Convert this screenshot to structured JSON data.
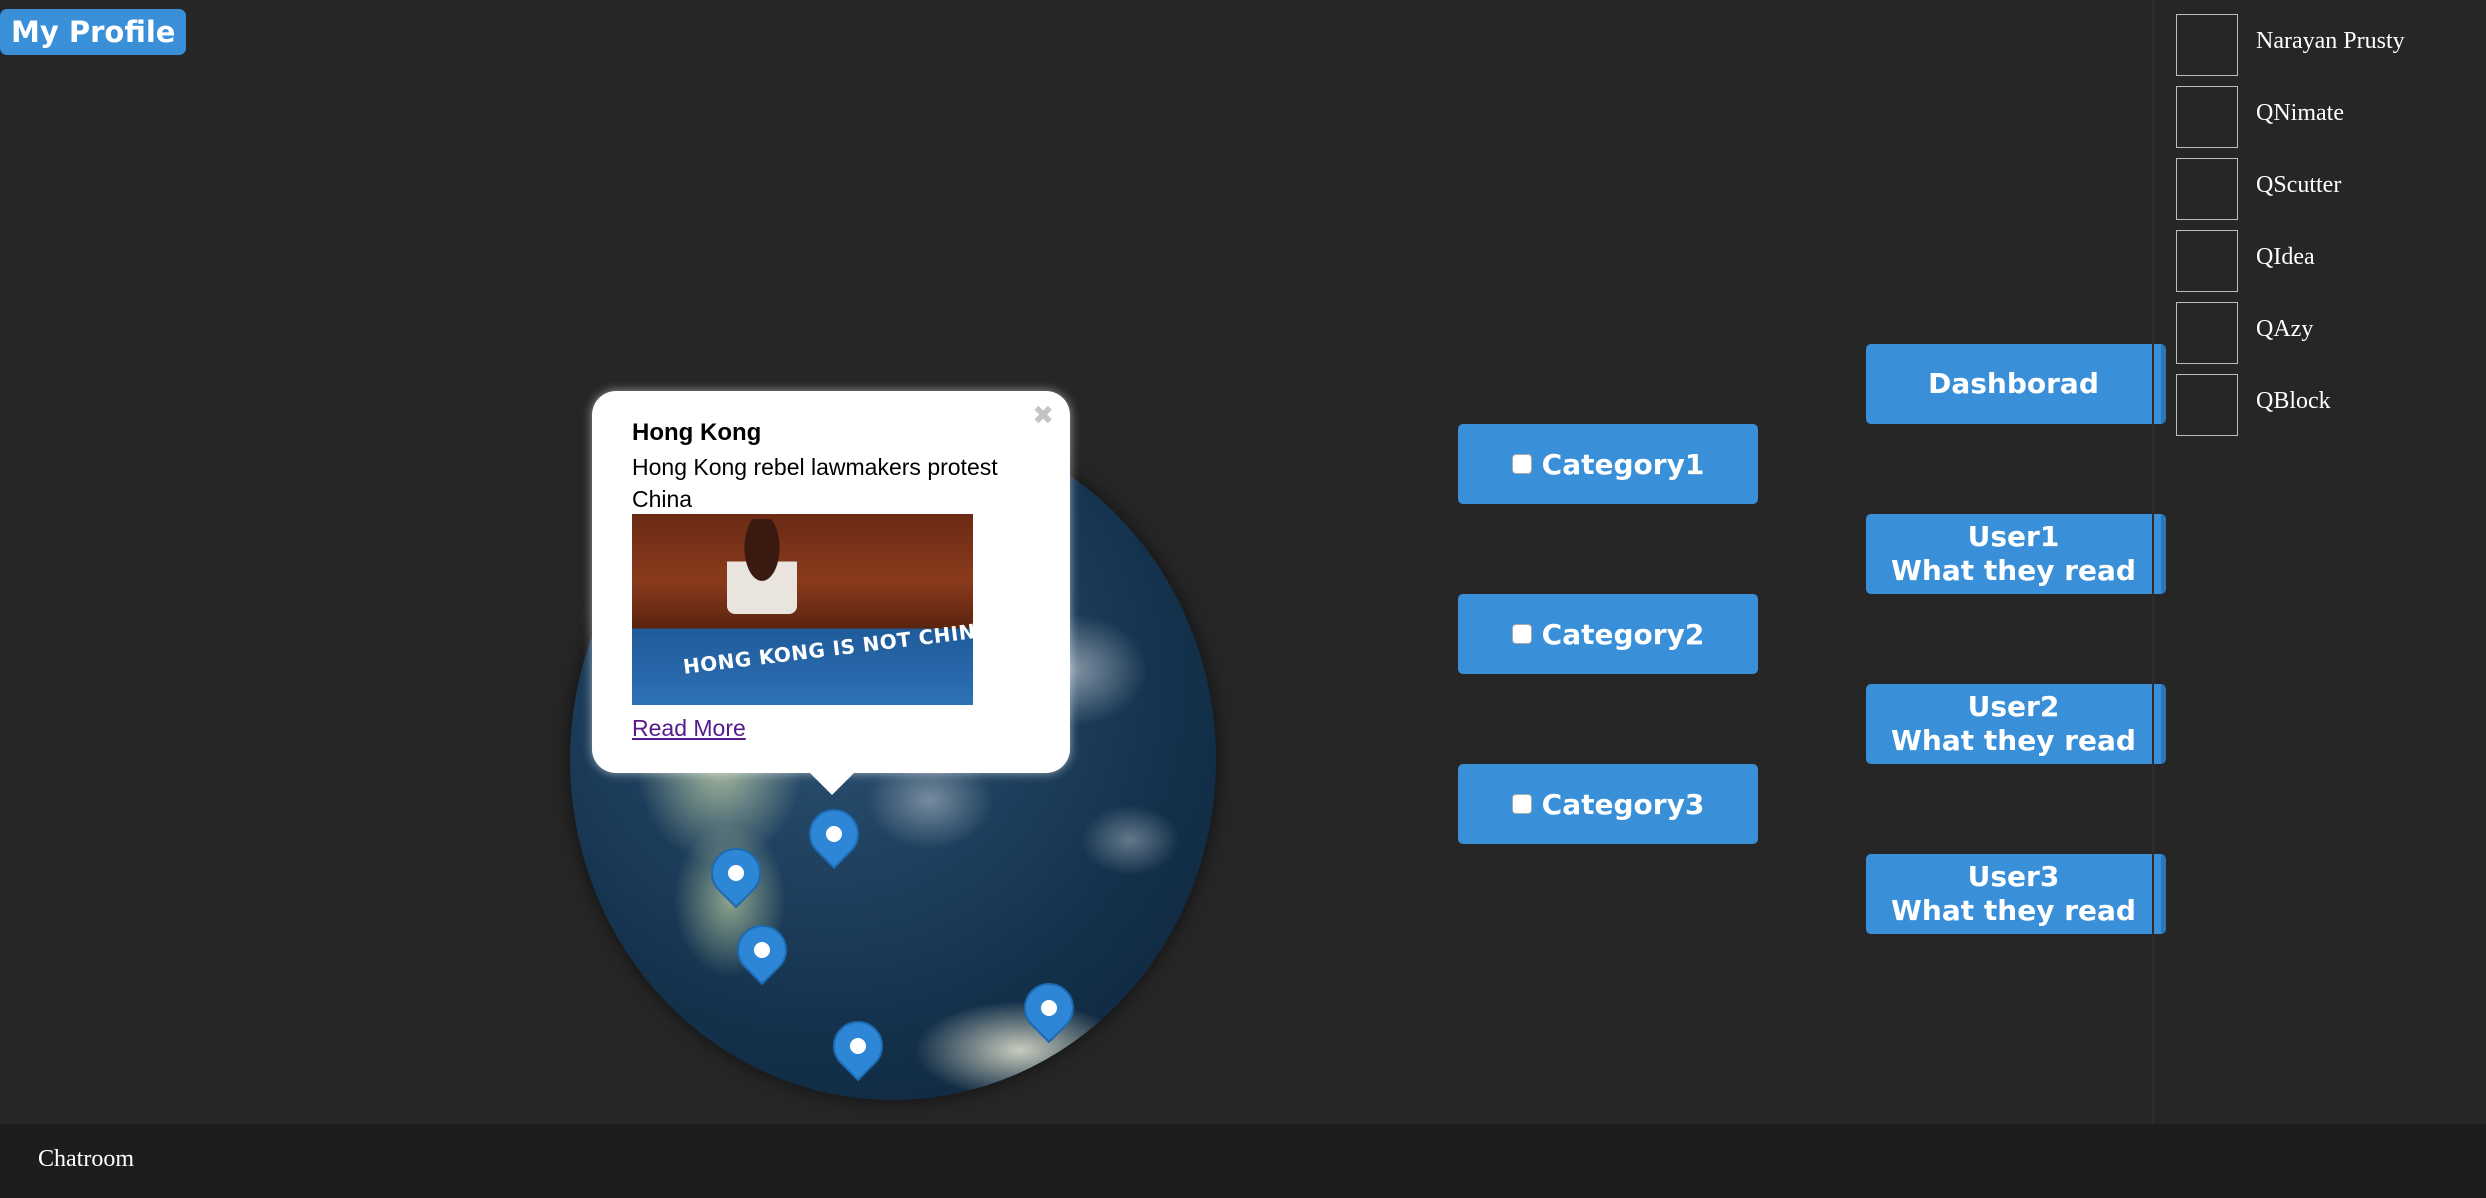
{
  "header": {
    "profile_label": "My Profile"
  },
  "popup": {
    "title": "Hong Kong",
    "description": "Hong Kong rebel lawmakers protest China",
    "image_caption": "HONG KONG IS NOT CHINA",
    "link_label": "Read More",
    "close_glyph": "✖"
  },
  "categories": [
    {
      "label": "Category1",
      "checked": false
    },
    {
      "label": "Category2",
      "checked": false
    },
    {
      "label": "Category3",
      "checked": false
    }
  ],
  "dashboard": {
    "label": "Dashborad"
  },
  "users": [
    {
      "name": "User1",
      "subtitle": "What they read"
    },
    {
      "name": "User2",
      "subtitle": "What they read"
    },
    {
      "name": "User3",
      "subtitle": "What they read"
    }
  ],
  "sidebar": {
    "items": [
      {
        "label": "Narayan Prusty"
      },
      {
        "label": "QNimate"
      },
      {
        "label": "QScutter"
      },
      {
        "label": "QIdea"
      },
      {
        "label": "QAzy"
      },
      {
        "label": "QBlock"
      }
    ]
  },
  "footer": {
    "chat_label": "Chatroom"
  },
  "colors": {
    "accent": "#3a8fd9",
    "background": "#262626",
    "footer": "#1d1d1d"
  }
}
